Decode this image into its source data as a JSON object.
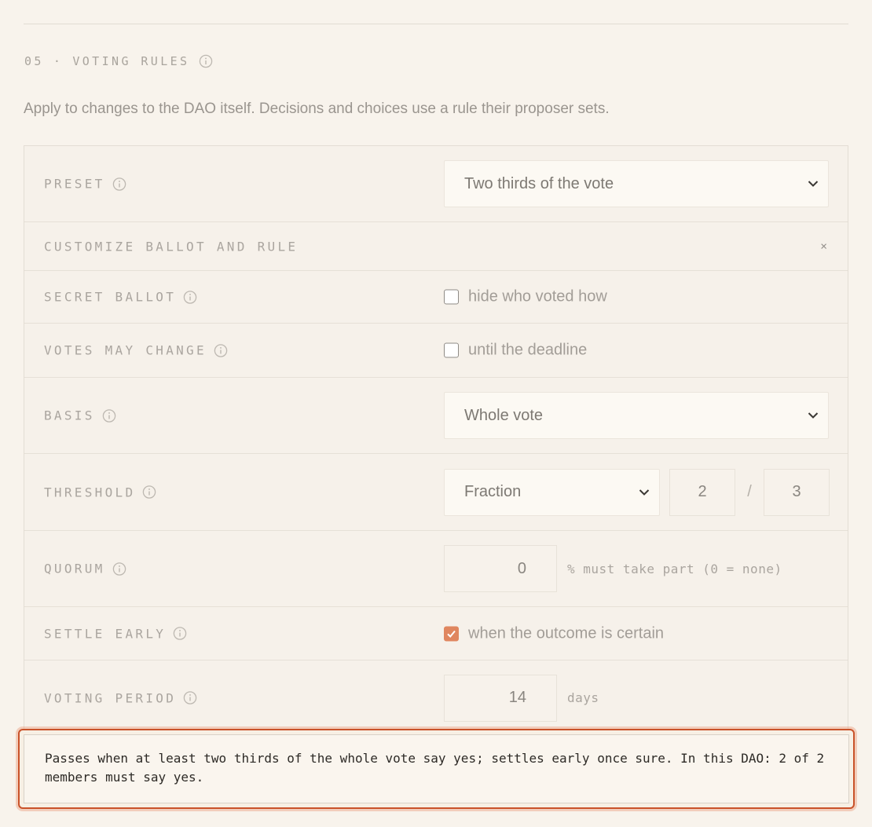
{
  "section": {
    "number": "05",
    "separator": "·",
    "title": "VOTING RULES",
    "description": "Apply to changes to the DAO itself. Decisions and choices use a rule their proposer sets."
  },
  "preset": {
    "label": "PRESET",
    "value": "Two thirds of the vote"
  },
  "customize": {
    "label": "CUSTOMIZE BALLOT AND RULE",
    "close": "×"
  },
  "secret_ballot": {
    "label": "SECRET BALLOT",
    "text": "hide who voted how",
    "checked": false
  },
  "votes_may_change": {
    "label": "VOTES MAY CHANGE",
    "text": "until the deadline",
    "checked": false
  },
  "basis": {
    "label": "BASIS",
    "value": "Whole vote"
  },
  "threshold": {
    "label": "THRESHOLD",
    "type": "Fraction",
    "numerator": "2",
    "slash": "/",
    "denominator": "3"
  },
  "quorum": {
    "label": "QUORUM",
    "value": "0",
    "suffix": "% must take part (0 = none)"
  },
  "settle_early": {
    "label": "SETTLE EARLY",
    "text": "when the outcome is certain",
    "checked": true
  },
  "voting_period": {
    "label": "VOTING PERIOD",
    "value": "14",
    "suffix": "days"
  },
  "summary": "Passes when at least two thirds of the whole vote say yes; settles early once sure. In this DAO: 2 of 2 members must say yes.",
  "colors": {
    "accent": "#e0865f",
    "highlight_border": "#c9522a",
    "background": "#f8f3ec"
  }
}
